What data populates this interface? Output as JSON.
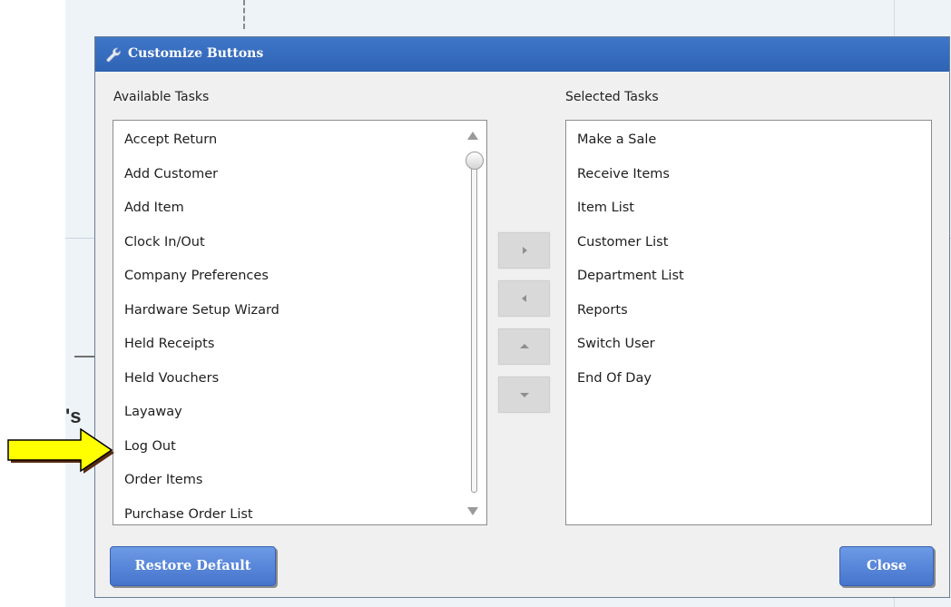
{
  "background": {
    "partial_text": "'s"
  },
  "dialog": {
    "title": "Customize Buttons",
    "title_icon": "wrench-icon",
    "available_label": "Available Tasks",
    "selected_label": "Selected Tasks",
    "available_tasks": [
      "Accept Return",
      "Add Customer",
      "Add Item",
      "Clock In/Out",
      "Company Preferences",
      "Hardware Setup Wizard",
      "Held Receipts",
      "Held Vouchers",
      "Layaway",
      "Log Out",
      "Order Items",
      "Purchase Order List"
    ],
    "selected_tasks": [
      "Make a Sale",
      "Receive Items",
      "Item List",
      "Customer List",
      "Department List",
      "Reports",
      "Switch User",
      "End Of Day"
    ],
    "buttons": {
      "restore_default": "Restore Default",
      "close": "Close"
    },
    "move_buttons": [
      "move-right-icon",
      "move-left-icon",
      "move-up-icon",
      "move-down-icon"
    ]
  },
  "annotation": {
    "arrow_icon": "yellow-pointer-arrow-icon",
    "points_to": "Log Out"
  },
  "colors": {
    "titlebar": "#2f63b4",
    "button": "#4f7fd6",
    "arrow_fill": "#ffff00"
  }
}
